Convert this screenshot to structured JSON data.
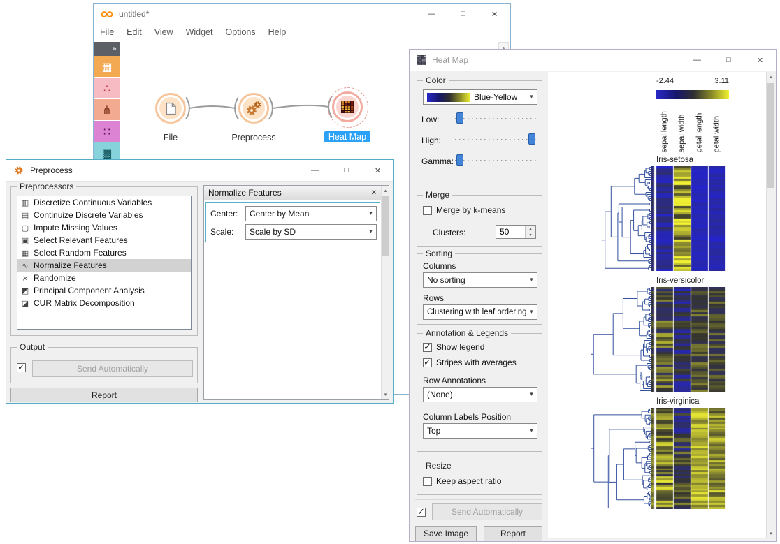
{
  "chrome": {
    "minimize": "—",
    "maximize": "□",
    "close": "✕",
    "scroll_up": "▴",
    "scroll_down": "▾"
  },
  "main_window": {
    "title": "untitled*",
    "menus": [
      "File",
      "Edit",
      "View",
      "Widget",
      "Options",
      "Help"
    ],
    "toolbox": {
      "chevron": "»",
      "categories": [
        {
          "icon": "data-table-icon",
          "glyph": "▦",
          "color": "#f2a952",
          "glyph_color": "#ffffff"
        },
        {
          "icon": "visualize-scatter-icon",
          "glyph": "∴",
          "color": "#f7bcc3",
          "glyph_color": "#c03a4a"
        },
        {
          "icon": "model-tree-icon",
          "glyph": "⋔",
          "color": "#f2ab90",
          "glyph_color": "#7c3018"
        },
        {
          "icon": "unsupervised-cluster-icon",
          "glyph": "∷",
          "color": "#dd83d3",
          "glyph_color": "#5c1460"
        },
        {
          "icon": "evaluate-grid-icon",
          "glyph": "▩",
          "color": "#86d3db",
          "glyph_color": "#14565e"
        }
      ]
    },
    "workflow": {
      "nodes": [
        {
          "label": "File",
          "icon": "file-widget-icon",
          "selected": false
        },
        {
          "label": "Preprocess",
          "icon": "preprocess-widget-icon",
          "selected": false
        },
        {
          "label": "Heat Map",
          "icon": "heatmap-widget-icon",
          "selected": true
        }
      ]
    }
  },
  "preprocess_window": {
    "title": "Preprocess",
    "preprocessors_group_label": "Preprocessors",
    "preprocessors": [
      {
        "label": "Discretize Continuous Variables",
        "icon": "discretize-icon",
        "glyph": "▥"
      },
      {
        "label": "Continuize Discrete Variables",
        "icon": "continuize-icon",
        "glyph": "▤"
      },
      {
        "label": "Impute Missing Values",
        "icon": "impute-icon",
        "glyph": "▢"
      },
      {
        "label": "Select Relevant Features",
        "icon": "select-relevant-icon",
        "glyph": "▣"
      },
      {
        "label": "Select Random Features",
        "icon": "select-random-icon",
        "glyph": "▦"
      },
      {
        "label": "Normalize Features",
        "icon": "normalize-icon",
        "glyph": "∿"
      },
      {
        "label": "Randomize",
        "icon": "randomize-icon",
        "glyph": "×"
      },
      {
        "label": "Principal Component Analysis",
        "icon": "pca-icon",
        "glyph": "◩"
      },
      {
        "label": "CUR Matrix Decomposition",
        "icon": "cur-icon",
        "glyph": "◪"
      }
    ],
    "selected_index": 5,
    "editor": {
      "title": "Normalize Features",
      "fields": [
        {
          "label": "Center:",
          "value": "Center by Mean"
        },
        {
          "label": "Scale:",
          "value": "Scale by SD"
        }
      ]
    },
    "output_label": "Output",
    "send_automatically_checked": true,
    "send_automatically_label": "Send Automatically",
    "report_label": "Report"
  },
  "heatmap_window": {
    "title": "Heat Map",
    "color_group": {
      "label": "Color",
      "palette": "Blue-Yellow",
      "sliders": [
        {
          "label": "Low:",
          "position": 0.02
        },
        {
          "label": "High:",
          "position": 0.97
        },
        {
          "label": "Gamma:",
          "position": 0.02
        }
      ]
    },
    "merge_group": {
      "label": "Merge",
      "kmeans_label": "Merge by k-means",
      "kmeans_checked": false,
      "clusters_label": "Clusters:",
      "clusters_value": "50"
    },
    "sorting_group": {
      "label": "Sorting",
      "columns_label": "Columns",
      "columns_value": "No sorting",
      "rows_label": "Rows",
      "rows_value": "Clustering with leaf ordering"
    },
    "annotation_group": {
      "label": "Annotation & Legends",
      "show_legend_label": "Show legend",
      "show_legend_checked": true,
      "stripes_label": "Stripes with averages",
      "stripes_checked": true,
      "row_annotations_label": "Row Annotations",
      "row_annotations_value": "(None)",
      "col_labels_pos_label": "Column Labels Position",
      "col_labels_pos_value": "Top"
    },
    "resize_group": {
      "label": "Resize",
      "keep_aspect_label": "Keep aspect ratio",
      "keep_aspect_checked": false
    },
    "send_automatically_checked": true,
    "send_automatically_label": "Send Automatically",
    "save_image_label": "Save Image",
    "report_label": "Report",
    "display": {
      "legend_min": "-2.44",
      "legend_max": "3.11",
      "columns": [
        "sepal length",
        "sepal width",
        "petal length",
        "petal width"
      ],
      "clusters": [
        {
          "name": "Iris-setosa",
          "rows": 50,
          "profile": [
            0.2,
            0.78,
            0.07,
            0.1
          ],
          "spread": [
            0.18,
            0.25,
            0.05,
            0.08
          ],
          "seed": 7
        },
        {
          "name": "Iris-versicolor",
          "rows": 50,
          "profile": [
            0.55,
            0.32,
            0.55,
            0.52
          ],
          "spread": [
            0.3,
            0.25,
            0.16,
            0.18
          ],
          "seed": 13
        },
        {
          "name": "Iris-virginica",
          "rows": 50,
          "profile": [
            0.68,
            0.42,
            0.82,
            0.75
          ],
          "spread": [
            0.3,
            0.3,
            0.15,
            0.2
          ],
          "seed": 29
        }
      ]
    },
    "colors": {
      "dendrogram": "#33519e",
      "heat_low": "#2323d2",
      "heat_mid": "#35352e",
      "heat_high": "#f2f233"
    }
  }
}
